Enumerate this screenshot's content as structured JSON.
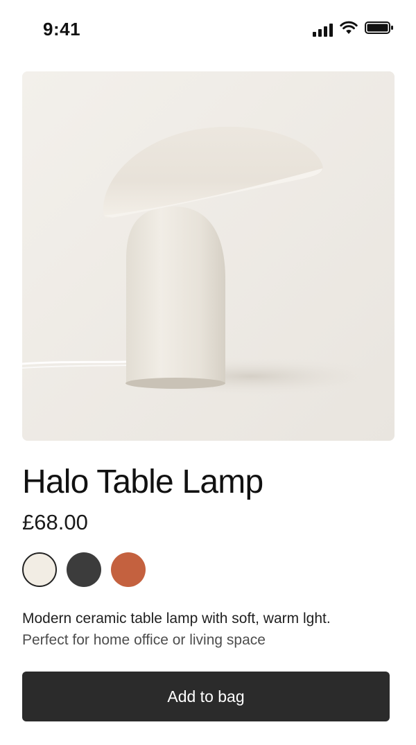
{
  "status_bar": {
    "time": "9:41",
    "icons": [
      "cellular-signal-icon",
      "wifi-icon",
      "battery-icon"
    ]
  },
  "product": {
    "image_icon": "table-lamp-photo",
    "title": "Halo Table Lamp",
    "price": "£68.00",
    "swatches": [
      {
        "name": "cream",
        "color": "#f2ede4",
        "selected": true
      },
      {
        "name": "charcoal",
        "color": "#3c3c3c",
        "selected": false
      },
      {
        "name": "terracotta",
        "color": "#c4613f",
        "selected": false
      }
    ],
    "description": {
      "line1": "Modern ceramic table lamp with soft, warm lght.",
      "line2": "Perfect for home office or living space"
    }
  },
  "cta": {
    "label": "Add to bag"
  },
  "colors": {
    "button_bg": "#2b2b2b",
    "image_bg": "#eeebe6"
  }
}
